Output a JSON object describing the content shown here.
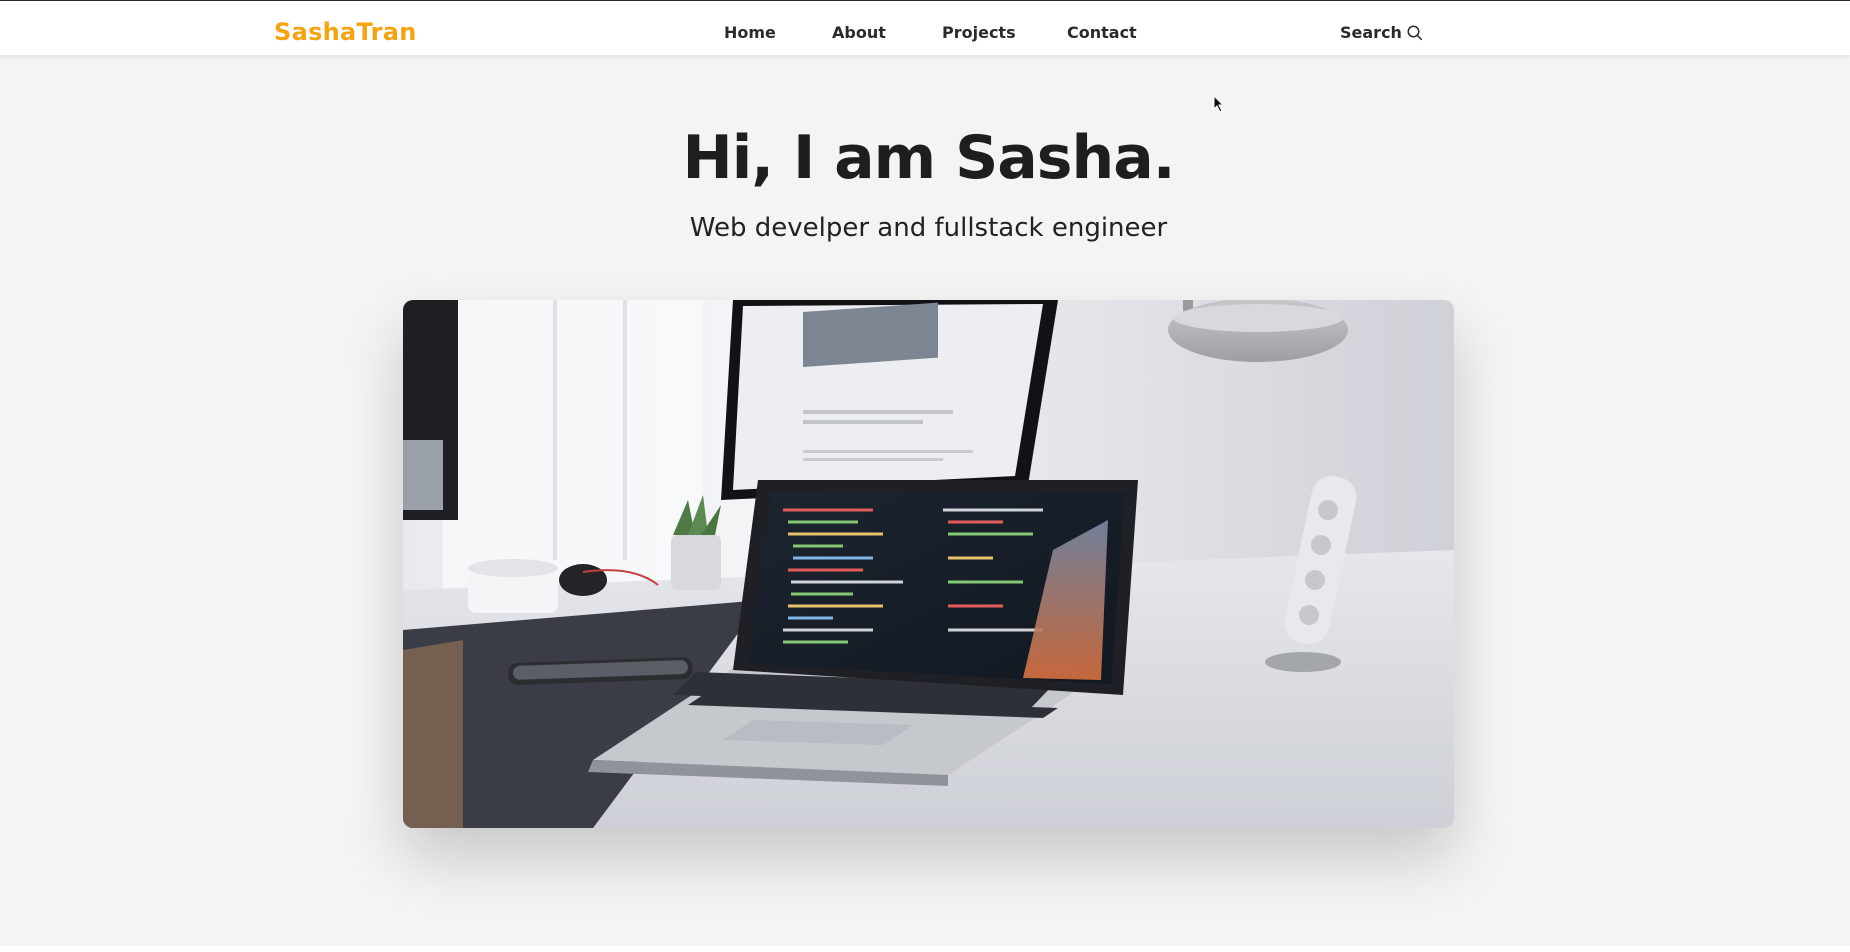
{
  "brand": {
    "name": "SashaTran",
    "color": "#f5a30e"
  },
  "nav": {
    "items": [
      {
        "label": "Home"
      },
      {
        "label": "About"
      },
      {
        "label": "Projects"
      },
      {
        "label": "Contact"
      }
    ],
    "search_label": "Search",
    "search_icon": "search-icon"
  },
  "hero": {
    "title": "Hi, I am Sasha.",
    "subtitle": "Web develper and fullstack engineer",
    "image_icon": "desk-laptop-photo"
  }
}
